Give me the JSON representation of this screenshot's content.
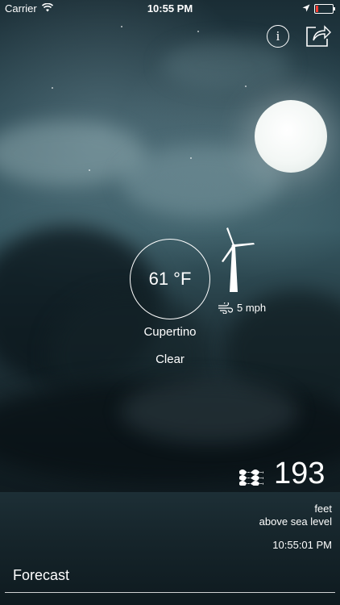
{
  "status_bar": {
    "carrier": "Carrier",
    "time": "10:55 PM",
    "battery_color": "#ff3b30"
  },
  "toolbar": {
    "info_icon": "info-icon",
    "share_icon": "share-icon",
    "info_glyph": "i"
  },
  "weather": {
    "temperature": "61 °F",
    "wind_speed": "5 mph",
    "city": "Cupertino",
    "condition": "Clear"
  },
  "elevation": {
    "value": "193",
    "unit": "feet",
    "reference": "above sea level",
    "timestamp": "10:55:01 PM"
  },
  "footer": {
    "forecast_label": "Forecast"
  }
}
